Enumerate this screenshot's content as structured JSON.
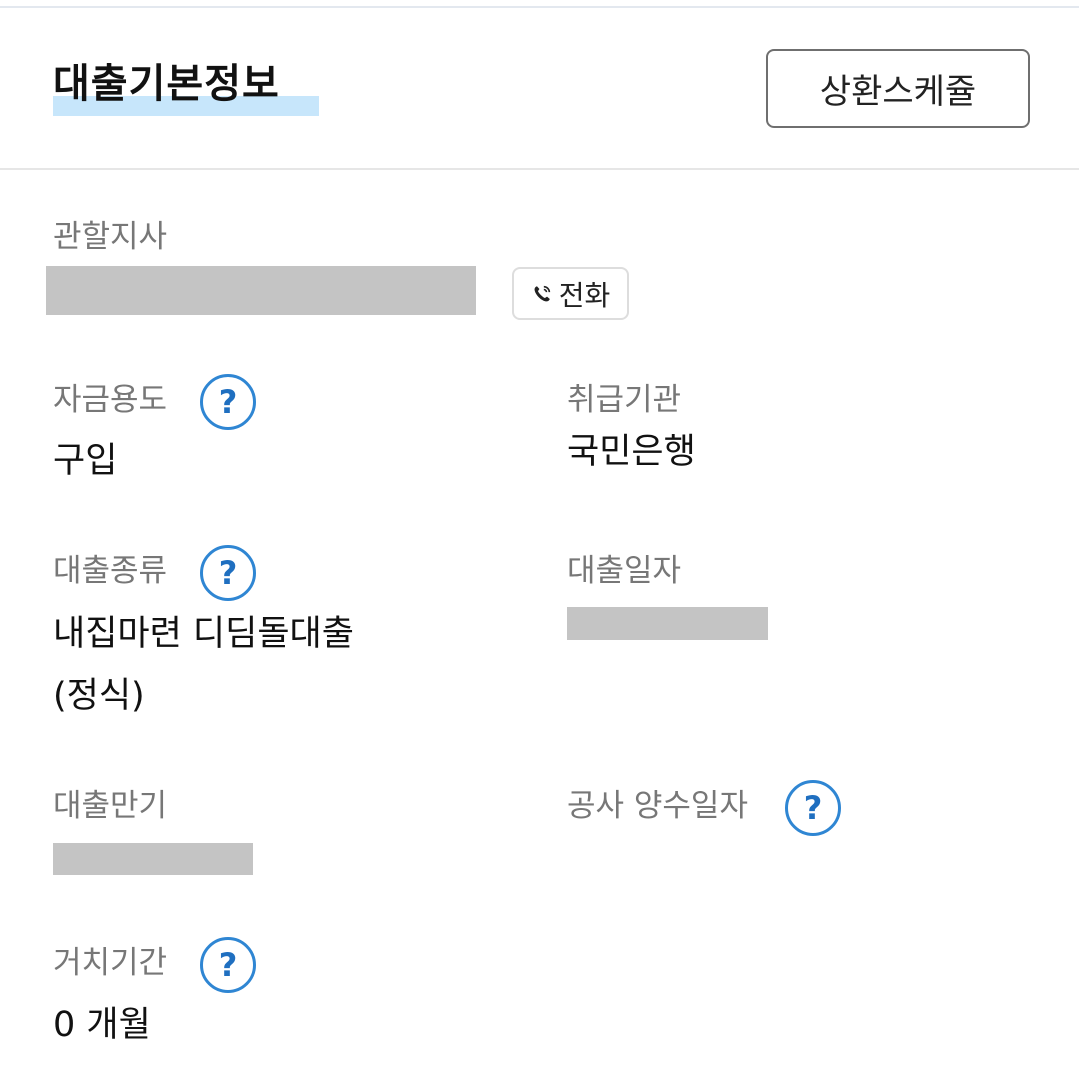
{
  "header": {
    "title": "대출기본정보",
    "schedule_button": "상환스케쥴"
  },
  "branch": {
    "label": "관할지사",
    "call_button": "전화"
  },
  "fields": {
    "fund_purpose": {
      "label": "자금용도",
      "value": "구입"
    },
    "handling_institution": {
      "label": "취급기관",
      "value": "국민은행"
    },
    "loan_type": {
      "label": "대출종류",
      "value_line1": "내집마련 디딤돌대출",
      "value_line2": "(정식)"
    },
    "loan_date": {
      "label": "대출일자"
    },
    "loan_maturity": {
      "label": "대출만기"
    },
    "construction_transfer_date": {
      "label": "공사 양수일자"
    },
    "grace_period": {
      "label": "거치기간",
      "value": "0 개월"
    }
  },
  "help_symbol": "?",
  "icons": {
    "help": "help-circle-icon",
    "phone": "phone-icon"
  },
  "colors": {
    "accent": "#2f86d3",
    "highlight": "#c7e6fb",
    "redact": "#c4c4c4"
  }
}
